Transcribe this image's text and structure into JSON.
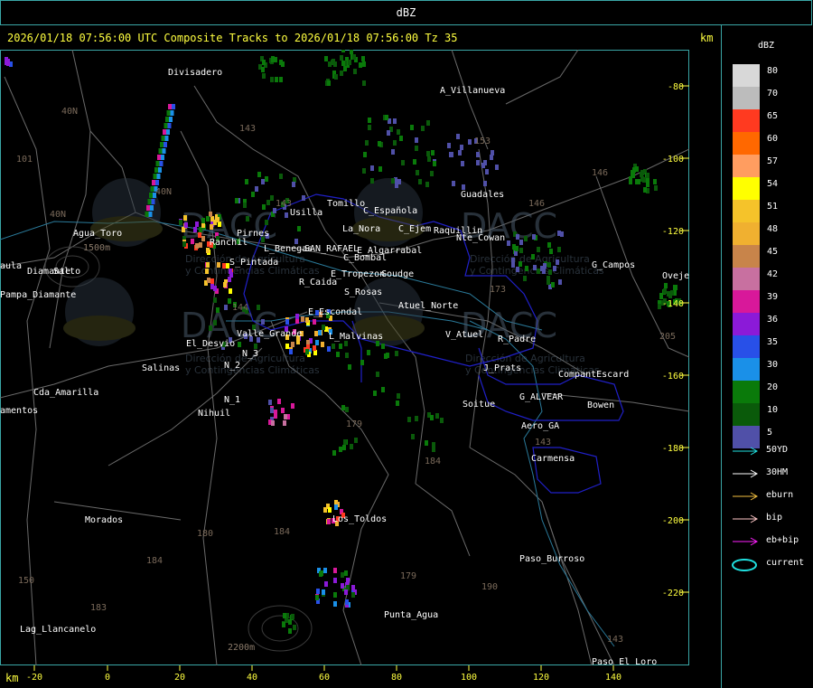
{
  "window": {
    "title": "dBZ"
  },
  "header": {
    "headline": "2026/01/18 07:56:00 UTC Composite Tracks to 2026/01/18 07:56:00 Tz 35",
    "km_label": "km"
  },
  "axes": {
    "x_unit": "km",
    "x_ticks": [
      "-20",
      "0",
      "20",
      "40",
      "60",
      "80",
      "100",
      "120",
      "140"
    ],
    "y_ticks": [
      "-80",
      "-100",
      "-120",
      "-140",
      "-160",
      "-180",
      "-200",
      "-220"
    ]
  },
  "legend": {
    "title": "dBZ",
    "scale": [
      {
        "value": "80",
        "color": "#d8d8d8"
      },
      {
        "value": "70",
        "color": "#bcbcbc"
      },
      {
        "value": "65",
        "color": "#ff3a20"
      },
      {
        "value": "60",
        "color": "#ff6800"
      },
      {
        "value": "57",
        "color": "#ff9d60"
      },
      {
        "value": "54",
        "color": "#ffff00"
      },
      {
        "value": "51",
        "color": "#f5c32a"
      },
      {
        "value": "48",
        "color": "#f0b030"
      },
      {
        "value": "45",
        "color": "#c8844a"
      },
      {
        "value": "42",
        "color": "#c870a0"
      },
      {
        "value": "39",
        "color": "#d8189a"
      },
      {
        "value": "36",
        "color": "#8b1ad8"
      },
      {
        "value": "35",
        "color": "#2850e8"
      },
      {
        "value": "30",
        "color": "#1a90e8"
      },
      {
        "value": "20",
        "color": "#0a7a0a"
      },
      {
        "value": "10",
        "color": "#0a5a0a"
      },
      {
        "value": "5",
        "color": "#5050a8"
      }
    ],
    "tracks": [
      {
        "label": "50YD",
        "color": "#20e0e0"
      },
      {
        "label": "30HM",
        "color": "#ffffff"
      },
      {
        "label": "eburn",
        "color": "#f5c040"
      },
      {
        "label": "bip",
        "color": "#ffc8c8"
      },
      {
        "label": "eb+bip",
        "color": "#ff20ff"
      },
      {
        "label": "current",
        "color": "#20e0e0"
      }
    ]
  },
  "map": {
    "places": [
      "Divisadero",
      "A_Villanueva",
      "Guadales",
      "Tomillo",
      "Usilla",
      "La_Nora",
      "C_Española",
      "C_Ejem",
      "Raquillin",
      "Nte_Cowan",
      "G_Campos",
      "Oveje",
      "Agua_Toro",
      "Ranchil",
      "Salto",
      "aula",
      "Pampa_Diamante",
      "Diamante",
      "Pirnes",
      "S_Pintada",
      "L_Benegas",
      "SAN_RAFAEL",
      "E_Algarrabal",
      "C_Bombal",
      "E_Tropezon",
      "Goudge",
      "R_Caida",
      "S_Rosas",
      "Atuel_Norte",
      "E_Escondal",
      "Valle_Grande",
      "L_Malvinas",
      "V_Atuel",
      "R_Padre",
      "El_Desvio",
      "Salinas",
      "N_3",
      "N_2",
      "J_Prats",
      "CompantEscard",
      "G_ALVEAR",
      "Cda_Amarilla",
      "amentos",
      "N_1",
      "Nihuil",
      "Soitue",
      "Bowen",
      "Aero_GA",
      "Carmensa",
      "Morados",
      "Los_Toldos",
      "Paso_Burroso",
      "Punta_Agua",
      "Lag_Llancanelo",
      "Paso_El_Loro"
    ],
    "route_numbers": [
      "101",
      "40N",
      "143",
      "153",
      "146",
      "146",
      "143",
      "144",
      "40N",
      "40N",
      "180",
      "184",
      "179",
      "184",
      "179",
      "190",
      "143",
      "184",
      "183",
      "150",
      "143",
      "205",
      "173"
    ],
    "contour_labels": [
      "1500m",
      "2200m"
    ],
    "watermark": {
      "brand": "DACC",
      "lines": [
        "Dirección de Agricultura",
        "y Contingencias Climáticas"
      ]
    }
  }
}
